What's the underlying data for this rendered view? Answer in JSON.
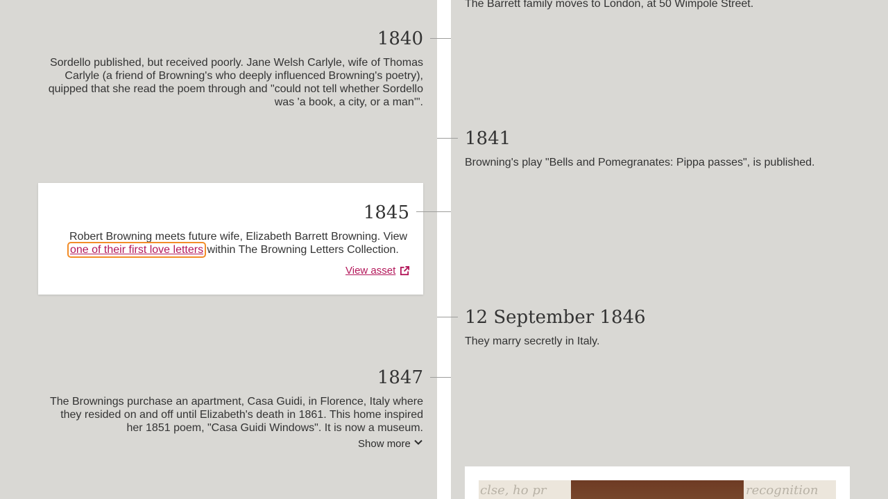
{
  "entries": {
    "top": {
      "text": "The Barrett family moves to London, at 50 Wimpole Street."
    },
    "e1840": {
      "year": "1840",
      "text": "Sordello published, but received poorly. Jane Welsh Carlyle, wife of Thomas Carlyle (a friend of Browning's who deeply influenced Browning's poetry), quipped that she read the poem through and \"could not tell whether Sordello was 'a book, a city, or a man'\"."
    },
    "e1841": {
      "year": "1841",
      "text": "Browning's play \"Bells and Pomegranates: Pippa passes\", is published."
    },
    "e1845": {
      "year": "1845",
      "text_before": "Robert Browning meets future wife, Elizabeth Barrett Browning. View ",
      "link_text": "one of their first love letters",
      "text_after": " within The Browning Letters Collection.",
      "view_asset_label": "View asset"
    },
    "e1846": {
      "year": "12 September 1846",
      "text": "They marry secretly in Italy."
    },
    "e1847": {
      "year": "1847",
      "text": "The Brownings purchase an apartment, Casa Guidi, in Florence, Italy where they resided on and off until Elizabeth's death in 1861. This home inspired her 1851 poem, \"Casa Guidi Windows\". It is now a museum.",
      "show_more_label": "Show more"
    }
  },
  "image_card": {
    "script_left": "clse, ho pr",
    "script_right": "recognition"
  },
  "colors": {
    "background": "#d9d8d4",
    "spine": "#ffffff",
    "link": "#b3175a",
    "focus": "#f28c28"
  },
  "icons": {
    "external_link": "external-link-icon",
    "chevron": "chevron-down-icon"
  }
}
